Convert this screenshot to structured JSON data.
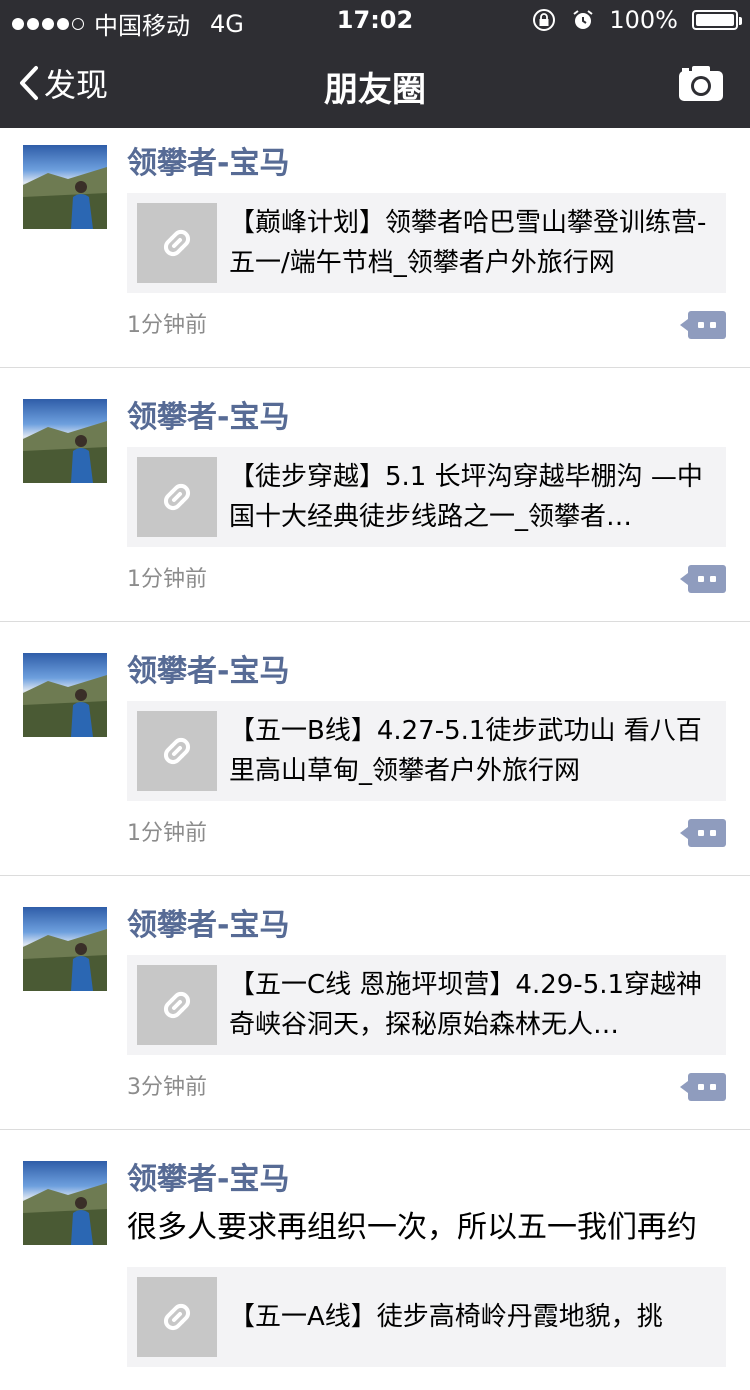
{
  "status_bar": {
    "carrier": "中国移动",
    "network": "4G",
    "time": "17:02",
    "battery": "100%",
    "battery_level": 1.0
  },
  "nav": {
    "back_label": "发现",
    "title": "朋友圈"
  },
  "posts": [
    {
      "author": "领攀者-宝马",
      "text": "",
      "link_title": "【巅峰计划】领攀者哈巴雪山攀登训练营-五一/端午节档_领攀者户外旅行网",
      "time": "1分钟前"
    },
    {
      "author": "领攀者-宝马",
      "text": "",
      "link_title": "【徒步穿越】5.1 长坪沟穿越毕棚沟 —中国十大经典徒步线路之一_领攀者…",
      "time": "1分钟前"
    },
    {
      "author": "领攀者-宝马",
      "text": "",
      "link_title": "【五一B线】4.27-5.1徒步武功山 看八百里高山草甸_领攀者户外旅行网",
      "time": "1分钟前"
    },
    {
      "author": "领攀者-宝马",
      "text": "",
      "link_title": "【五一C线 恩施坪坝营】4.29-5.1穿越神奇峡谷洞天，探秘原始森林无人…",
      "time": "3分钟前"
    },
    {
      "author": "领攀者-宝马",
      "text": "很多人要求再组织一次，所以五一我们再约",
      "link_title": "【五一A线】徒步高椅岭丹霞地貌，挑",
      "time": ""
    }
  ],
  "colors": {
    "bar_bg": "#2e2e33",
    "author": "#576b95",
    "comment_btn": "#8f9cbe"
  }
}
